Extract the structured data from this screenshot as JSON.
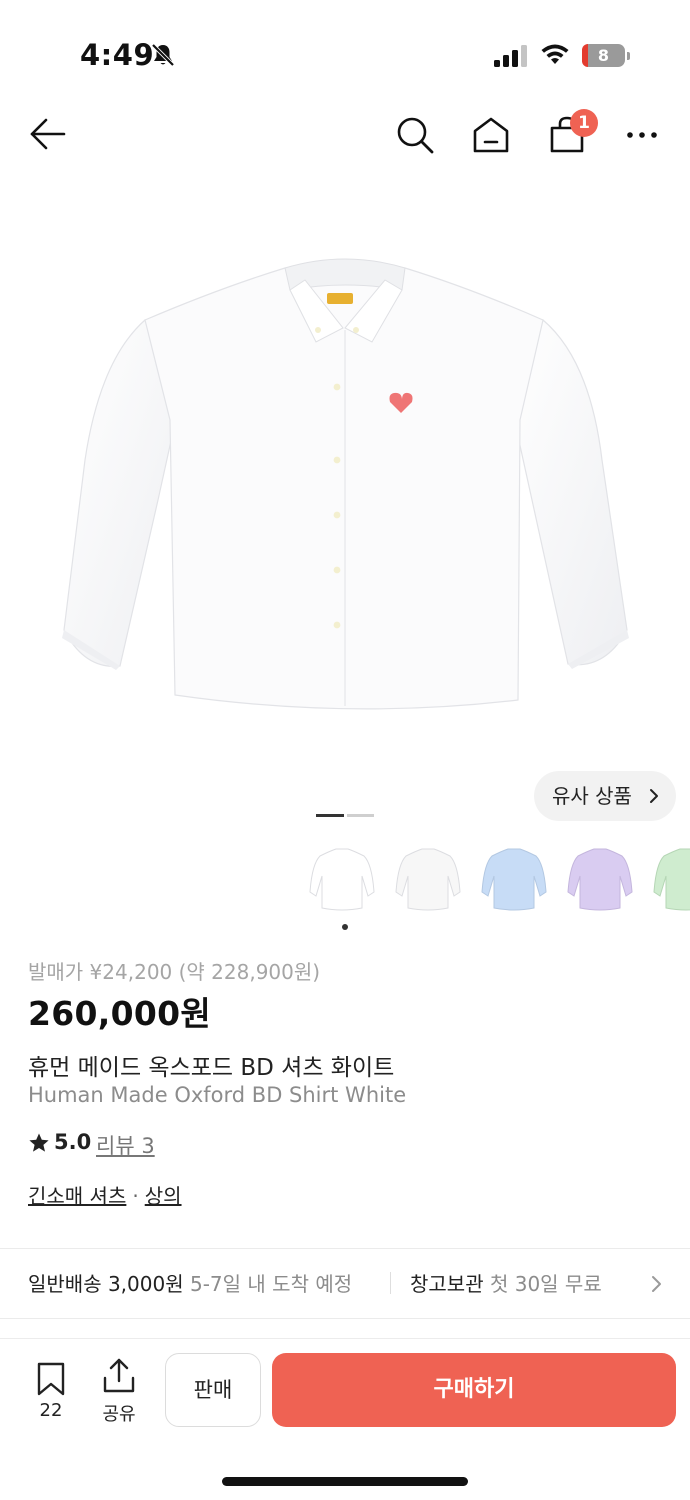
{
  "status_bar": {
    "time": "4:49",
    "battery": "8"
  },
  "nav": {
    "cart_count": "1"
  },
  "gallery": {
    "similar_label": "유사 상품",
    "thumbnail_colors": [
      "#ffffff",
      "#f7f7f7",
      "#c7dcf6",
      "#d9ccf1",
      "#cfeccf"
    ]
  },
  "product": {
    "release_price": "발매가 ¥24,200 (약 228,900원)",
    "price": "260,000원",
    "name_ko": "휴먼 메이드 옥스포드 BD 셔츠 화이트",
    "name_en": "Human Made Oxford BD Shirt White",
    "rating": "5.0",
    "review_label": "리뷰 3",
    "categories": [
      "긴소매 셔츠",
      "상의"
    ],
    "category_sep": "·"
  },
  "shipping": {
    "method": "일반배송 3,000원",
    "eta": "5-7일 내 도착 예정",
    "storage": "창고보관",
    "storage_note": "첫 30일 무료"
  },
  "bottom_bar": {
    "bookmark_count": "22",
    "share_label": "공유",
    "sell_label": "판매",
    "buy_label": "구매하기"
  },
  "colors": {
    "accent": "#ef6253"
  }
}
